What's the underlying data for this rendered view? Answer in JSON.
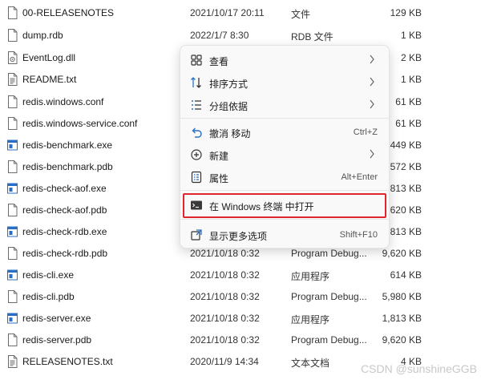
{
  "files": [
    {
      "name": "00-RELEASENOTES",
      "date": "2021/10/17 20:11",
      "type": "文件",
      "size": "129 KB",
      "icon": "file-icon"
    },
    {
      "name": "dump.rdb",
      "date": "2022/1/7 8:30",
      "type": "RDB 文件",
      "size": "1 KB",
      "icon": "file-icon"
    },
    {
      "name": "EventLog.dll",
      "date": "",
      "type": "",
      "size": "2 KB",
      "icon": "dll-file-icon"
    },
    {
      "name": "README.txt",
      "date": "",
      "type": "",
      "size": "1 KB",
      "icon": "text-file-icon"
    },
    {
      "name": "redis.windows.conf",
      "date": "",
      "type": "",
      "size": "61 KB",
      "icon": "file-icon"
    },
    {
      "name": "redis.windows-service.conf",
      "date": "",
      "type": "",
      "size": "61 KB",
      "icon": "file-icon"
    },
    {
      "name": "redis-benchmark.exe",
      "date": "",
      "type": "",
      "size": "449 KB",
      "icon": "exe-file-icon"
    },
    {
      "name": "redis-benchmark.pdb",
      "date": "",
      "type": "",
      "size": ",572 KB",
      "icon": "file-icon"
    },
    {
      "name": "redis-check-aof.exe",
      "date": "",
      "type": "",
      "size": ",813 KB",
      "icon": "exe-file-icon"
    },
    {
      "name": "redis-check-aof.pdb",
      "date": "",
      "type": "",
      "size": ",620 KB",
      "icon": "file-icon"
    },
    {
      "name": "redis-check-rdb.exe",
      "date": "",
      "type": "",
      "size": ",813 KB",
      "icon": "exe-file-icon"
    },
    {
      "name": "redis-check-rdb.pdb",
      "date": "2021/10/18 0:32",
      "type": "Program Debug...",
      "size": "9,620 KB",
      "icon": "file-icon"
    },
    {
      "name": "redis-cli.exe",
      "date": "2021/10/18 0:32",
      "type": "应用程序",
      "size": "614 KB",
      "icon": "exe-file-icon"
    },
    {
      "name": "redis-cli.pdb",
      "date": "2021/10/18 0:32",
      "type": "Program Debug...",
      "size": "5,980 KB",
      "icon": "file-icon"
    },
    {
      "name": "redis-server.exe",
      "date": "2021/10/18 0:32",
      "type": "应用程序",
      "size": "1,813 KB",
      "icon": "exe-file-icon"
    },
    {
      "name": "redis-server.pdb",
      "date": "2021/10/18 0:32",
      "type": "Program Debug...",
      "size": "9,620 KB",
      "icon": "file-icon"
    },
    {
      "name": "RELEASENOTES.txt",
      "date": "2020/11/9 14:34",
      "type": "文本文档",
      "size": "4 KB",
      "icon": "text-file-icon"
    }
  ],
  "context_menu": {
    "items": [
      {
        "label": "查看",
        "icon": "grid-view-icon",
        "submenu": true,
        "shortcut": ""
      },
      {
        "label": "排序方式",
        "icon": "sort-icon",
        "submenu": true,
        "shortcut": ""
      },
      {
        "label": "分组依据",
        "icon": "group-by-icon",
        "submenu": true,
        "shortcut": ""
      },
      {
        "label": "撤消 移动",
        "icon": "undo-icon",
        "submenu": false,
        "shortcut": "Ctrl+Z"
      },
      {
        "label": "新建",
        "icon": "new-icon",
        "submenu": true,
        "shortcut": ""
      },
      {
        "label": "属性",
        "icon": "properties-icon",
        "submenu": false,
        "shortcut": "Alt+Enter"
      },
      {
        "label": "在 Windows 终端 中打开",
        "icon": "terminal-icon",
        "submenu": false,
        "shortcut": ""
      },
      {
        "label": "显示更多选项",
        "icon": "more-options-icon",
        "submenu": false,
        "shortcut": "Shift+F10"
      }
    ],
    "highlight_color": "#e0262b"
  },
  "watermark": "CSDN @sunshineGGB"
}
